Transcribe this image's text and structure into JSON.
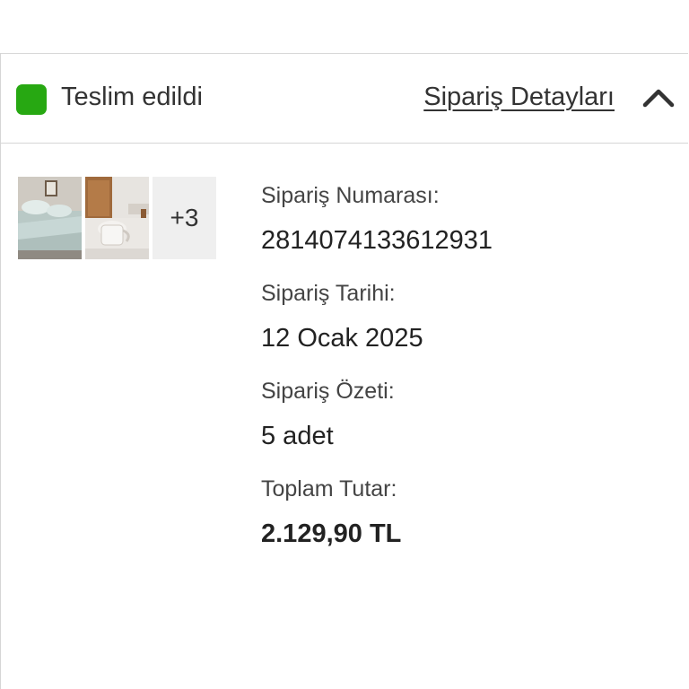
{
  "order": {
    "status_label": "Teslim edildi",
    "status_color": "#27a812",
    "details_link": "Sipariş Detayları",
    "collapse_icon": "chevron-up-icon",
    "thumbnails": [
      "bedroom-product-image",
      "tea-set-product-image"
    ],
    "more_count": "+3",
    "order_number_label": "Sipariş Numarası:",
    "order_number": "2814074133612931",
    "order_date_label": "Sipariş Tarihi:",
    "order_date": "12 Ocak 2025",
    "summary_label": "Sipariş Özeti:",
    "summary": "5 adet",
    "total_label": "Toplam Tutar:",
    "total": "2.129,90 TL"
  }
}
